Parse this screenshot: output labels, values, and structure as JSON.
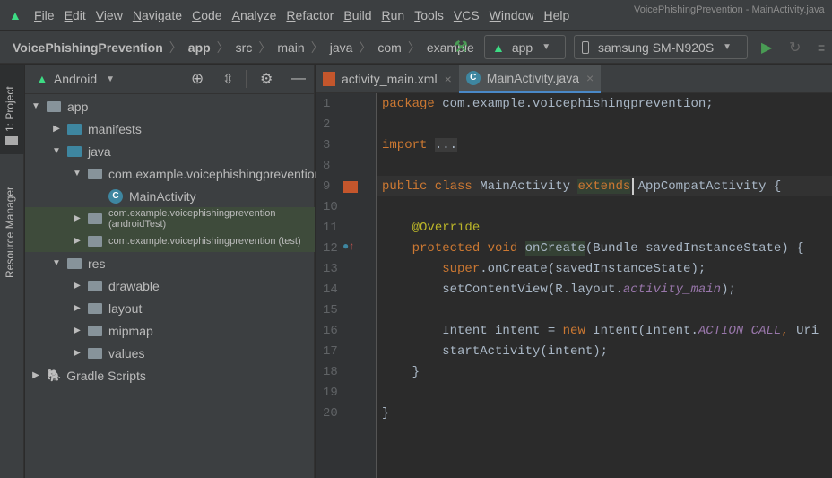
{
  "menu": {
    "items": [
      "File",
      "Edit",
      "View",
      "Navigate",
      "Code",
      "Analyze",
      "Refactor",
      "Build",
      "Run",
      "Tools",
      "VCS",
      "Window",
      "Help"
    ],
    "window_title": "VoicePhishingPrevention - MainActivity.java"
  },
  "nav": {
    "crumbs": [
      "VoicePhishingPrevention",
      "app",
      "src",
      "main",
      "java",
      "com",
      "example"
    ],
    "run_config": "app",
    "device": "samsung SM-N920S"
  },
  "sidebar": {
    "project_tab": "1: Project",
    "resource_tab": "Resource Manager"
  },
  "panel": {
    "view": "Android",
    "tree": [
      {
        "label": "app",
        "depth": 0,
        "open": true,
        "icon": "module-folder"
      },
      {
        "label": "manifests",
        "depth": 1,
        "open": false,
        "icon": "folder"
      },
      {
        "label": "java",
        "depth": 1,
        "open": true,
        "icon": "folder"
      },
      {
        "label": "com.example.voicephishingprevention",
        "depth": 2,
        "open": true,
        "icon": "package"
      },
      {
        "label": "MainActivity",
        "depth": 3,
        "icon": "class"
      },
      {
        "label": "com.example.voicephishingprevention (androidTest)",
        "depth": 2,
        "open": false,
        "icon": "package",
        "hl": true
      },
      {
        "label": "com.example.voicephishingprevention (test)",
        "depth": 2,
        "open": false,
        "icon": "package",
        "hl": true
      },
      {
        "label": "res",
        "depth": 1,
        "open": true,
        "icon": "res-folder"
      },
      {
        "label": "drawable",
        "depth": 2,
        "open": false,
        "icon": "package"
      },
      {
        "label": "layout",
        "depth": 2,
        "open": false,
        "icon": "package"
      },
      {
        "label": "mipmap",
        "depth": 2,
        "open": false,
        "icon": "package"
      },
      {
        "label": "values",
        "depth": 2,
        "open": false,
        "icon": "package"
      },
      {
        "label": "Gradle Scripts",
        "depth": 0,
        "open": false,
        "icon": "gradle"
      }
    ]
  },
  "tabs": [
    {
      "label": "activity_main.xml",
      "active": false
    },
    {
      "label": "MainActivity.java",
      "active": true
    }
  ],
  "editor": {
    "lines": [
      {
        "n": "1",
        "tokens": [
          [
            "kw",
            "package "
          ],
          [
            "",
            "com.example.voicephishingprevention;"
          ]
        ]
      },
      {
        "n": "2",
        "tokens": []
      },
      {
        "n": "3",
        "tokens": [
          [
            "kw",
            "import "
          ],
          [
            "fold-bg",
            "..."
          ]
        ]
      },
      {
        "n": "8",
        "tokens": []
      },
      {
        "n": "9",
        "tokens": [
          [
            "kw",
            "public class "
          ],
          [
            "",
            "MainActivity "
          ],
          [
            "kw hlw",
            "extends"
          ],
          [
            "",
            " AppCompatActivity {"
          ]
        ]
      },
      {
        "n": "10",
        "tokens": []
      },
      {
        "n": "11",
        "tokens": [
          [
            "",
            "    "
          ],
          [
            "an",
            "@Override"
          ]
        ]
      },
      {
        "n": "12",
        "tokens": [
          [
            "kw",
            "    protected void "
          ],
          [
            "hlw",
            "onCreate"
          ],
          [
            "",
            "(Bundle savedInstanceState) {"
          ]
        ]
      },
      {
        "n": "13",
        "tokens": [
          [
            "kw",
            "        super"
          ],
          [
            "",
            ".onCreate(savedInstanceState);"
          ]
        ]
      },
      {
        "n": "14",
        "tokens": [
          [
            "",
            "        setContentView(R.layout."
          ],
          [
            "it",
            "activity_main"
          ],
          [
            "",
            ");"
          ]
        ]
      },
      {
        "n": "15",
        "tokens": []
      },
      {
        "n": "16",
        "tokens": [
          [
            "",
            "        Intent intent = "
          ],
          [
            "kw",
            "new "
          ],
          [
            "",
            "Intent(Intent."
          ],
          [
            "it",
            "ACTION_CALL"
          ],
          [
            "kw",
            ", "
          ],
          [
            "",
            "Uri"
          ]
        ]
      },
      {
        "n": "17",
        "tokens": [
          [
            "",
            "        startActivity(intent);"
          ]
        ]
      },
      {
        "n": "18",
        "tokens": [
          [
            "",
            "    }"
          ]
        ]
      },
      {
        "n": "19",
        "tokens": []
      },
      {
        "n": "20",
        "tokens": [
          [
            "",
            "}"
          ]
        ]
      }
    ]
  }
}
